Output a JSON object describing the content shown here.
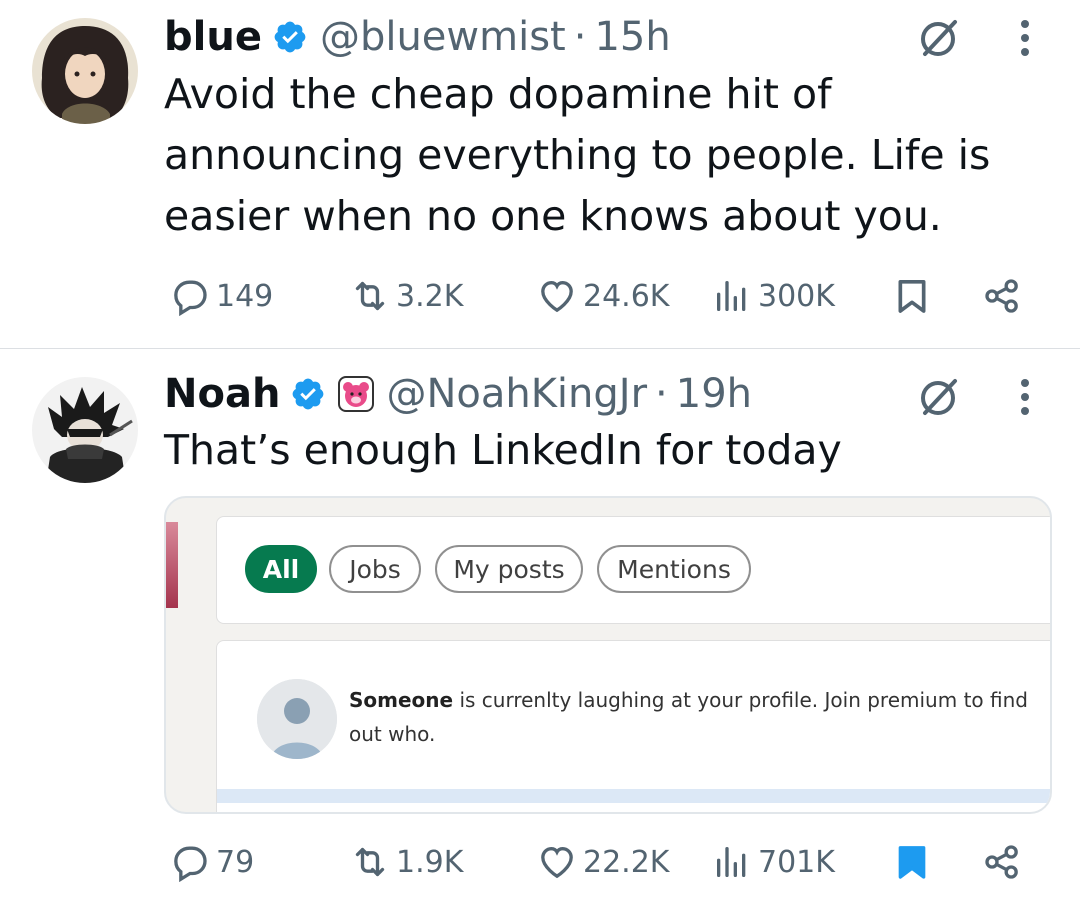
{
  "colors": {
    "text": "#0f1419",
    "muted": "#536471",
    "verified": "#1d9bf0",
    "bookmark_active": "#1d9bf0",
    "linkedin_green": "#067a4f"
  },
  "tweets": [
    {
      "name": "blue",
      "handle": "@bluewmist",
      "separator": "·",
      "time": "15h",
      "text_lines": [
        "Avoid the cheap dopamine hit of",
        "announcing everything to people. Life is",
        "easier when no one knows about you."
      ],
      "stats": {
        "replies": "149",
        "reposts": "3.2K",
        "likes": "24.6K",
        "views": "300K"
      },
      "bookmarked": false
    },
    {
      "name": "Noah",
      "handle": "@NoahKingJr",
      "separator": "·",
      "time": "19h",
      "text_lines": [
        "That’s enough LinkedIn for today"
      ],
      "media": {
        "filters": [
          "All",
          "Jobs",
          "My posts",
          "Mentions"
        ],
        "active_filter": "All",
        "notification_bold": "Someone",
        "notification_line1": " is currenlty laughing at your profile. Join premium to find",
        "notification_line2": "out who."
      },
      "stats": {
        "replies": "79",
        "reposts": "1.9K",
        "likes": "22.2K",
        "views": "701K"
      },
      "bookmarked": true
    }
  ]
}
